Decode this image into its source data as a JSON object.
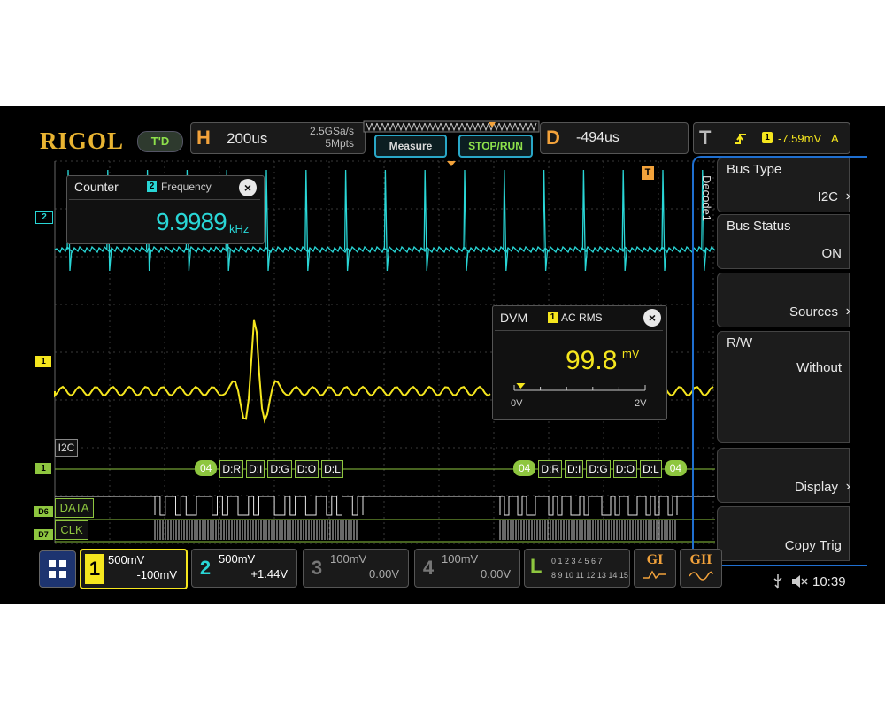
{
  "brand": {
    "logo": "RIGOL",
    "mode": "T'D"
  },
  "horizontal": {
    "label": "H",
    "timebase": "200us",
    "sample_rate": "2.5GSa/s",
    "memory": "5Mpts"
  },
  "buttons": {
    "measure": "Measure",
    "stop_run": "STOP/RUN"
  },
  "delay": {
    "label": "D",
    "value": "-494us"
  },
  "trigger": {
    "label": "T",
    "channel": "1",
    "level": "-7.59mV",
    "mode": "A"
  },
  "counter": {
    "title": "Counter",
    "source": "2",
    "type": "Frequency",
    "value": "9.9989",
    "unit": "kHz",
    "close": "×"
  },
  "dvm": {
    "title": "DVM",
    "source": "1",
    "type": "AC RMS",
    "value": "99.8",
    "unit": "mV",
    "scale_min": "0V",
    "scale_max": "2V",
    "level_fraction": 0.05,
    "close": "×"
  },
  "markers": {
    "ch2": "2",
    "ch1": "1",
    "i2c": "I2C",
    "bus": "1",
    "d6": "D6",
    "d7": "D7",
    "data": "DATA",
    "clk": "CLK",
    "trig": "T"
  },
  "decode_frames": [
    {
      "chips": [
        "04",
        "D:R",
        "D:I",
        "D:G",
        "D:O",
        "D:L"
      ]
    },
    {
      "chips": [
        "04",
        "D:R",
        "D:I",
        "D:G",
        "D:O",
        "D:L",
        "04"
      ]
    }
  ],
  "menu": {
    "tab": "Decode1",
    "items": [
      {
        "title": "Bus Type",
        "value": "I2C"
      },
      {
        "title": "Bus Status",
        "value": "ON"
      },
      {
        "title": "",
        "value": "Sources"
      },
      {
        "title": "R/W",
        "value": "Without"
      },
      {
        "title": "",
        "value": "Display"
      },
      {
        "title": "",
        "value": "Copy Trig"
      }
    ]
  },
  "channels": [
    {
      "num": "1",
      "scale": "500mV",
      "offset": "-100mV",
      "color": "#f5e61e"
    },
    {
      "num": "2",
      "scale": "500mV",
      "offset": "+1.44V",
      "color": "#29d6d6"
    },
    {
      "num": "3",
      "scale": "100mV",
      "offset": "0.00V",
      "color": "#777777"
    },
    {
      "num": "4",
      "scale": "100mV",
      "offset": "0.00V",
      "color": "#777777"
    }
  ],
  "logic": {
    "label": "L",
    "row1": "0 1 2 3  4 5 6 7",
    "row2": "8 9 10 11 12 13 14 15"
  },
  "generators": {
    "g1": "GI",
    "g2": "GII"
  },
  "status": {
    "time": "10:39"
  },
  "colors": {
    "ch1": "#f5e61e",
    "ch2": "#29d6d6",
    "logic": "#8ec63f",
    "accent": "#f2a23b",
    "menu_border": "#1f6fd0"
  }
}
